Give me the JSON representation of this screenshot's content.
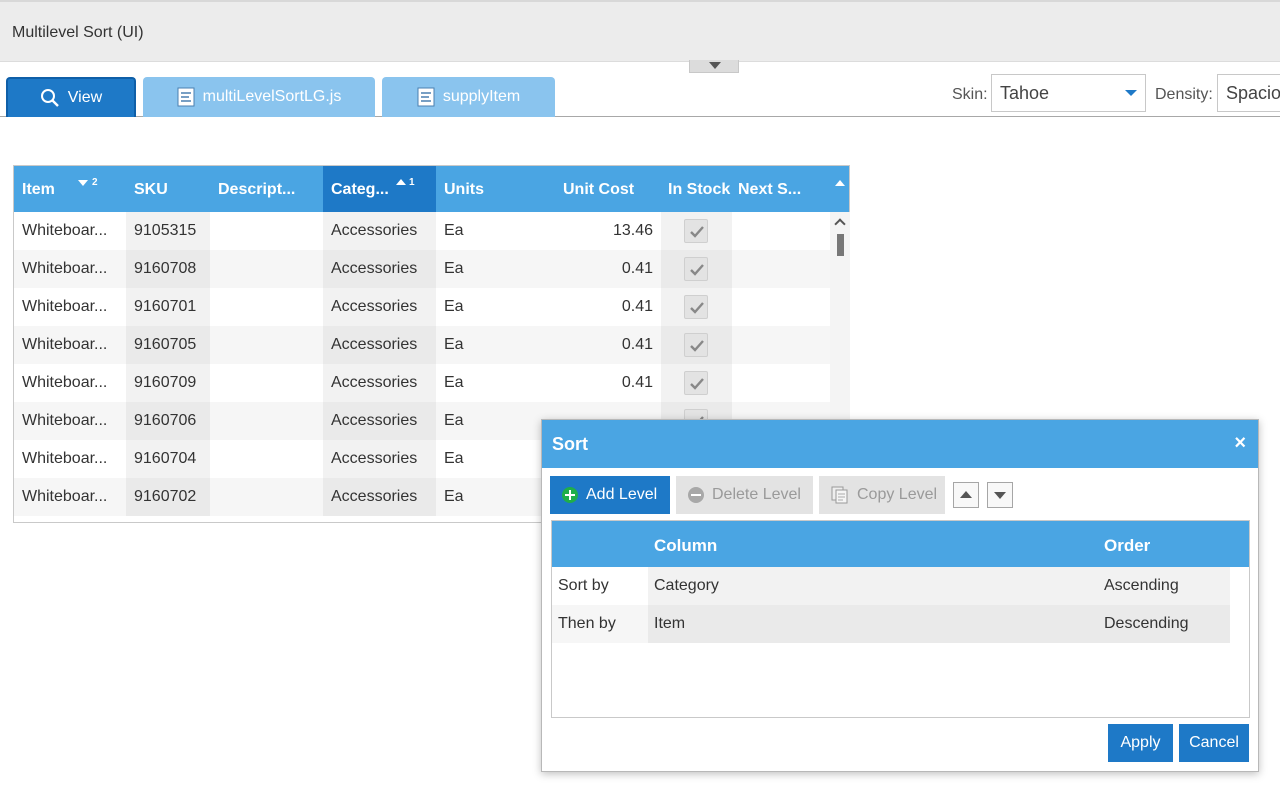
{
  "window": {
    "title": "Multilevel Sort (UI)"
  },
  "tabs": [
    {
      "label": "View",
      "icon": "search-icon",
      "active": true
    },
    {
      "label": "multiLevelSortLG.js",
      "icon": "document-icon",
      "active": false
    },
    {
      "label": "supplyItem",
      "icon": "document-icon",
      "active": false
    }
  ],
  "skin": {
    "label": "Skin:",
    "value": "Tahoe"
  },
  "density": {
    "label": "Density:",
    "value": "Spacious"
  },
  "grid": {
    "columns": [
      {
        "label": "Item",
        "sort": "descending",
        "sort_level": "2"
      },
      {
        "label": "SKU"
      },
      {
        "label": "Descript..."
      },
      {
        "label": "Categ...",
        "sort": "ascending",
        "sort_level": "1"
      },
      {
        "label": "Units"
      },
      {
        "label": "Unit Cost"
      },
      {
        "label": "In Stock"
      },
      {
        "label": "Next S..."
      }
    ],
    "rows": [
      {
        "item": "Whiteboar...",
        "sku": "9105315",
        "description": "",
        "category": "Accessories",
        "units": "Ea",
        "unit_cost": "13.46",
        "in_stock": true,
        "next_shipment": ""
      },
      {
        "item": "Whiteboar...",
        "sku": "9160708",
        "description": "",
        "category": "Accessories",
        "units": "Ea",
        "unit_cost": "0.41",
        "in_stock": true,
        "next_shipment": ""
      },
      {
        "item": "Whiteboar...",
        "sku": "9160701",
        "description": "",
        "category": "Accessories",
        "units": "Ea",
        "unit_cost": "0.41",
        "in_stock": true,
        "next_shipment": ""
      },
      {
        "item": "Whiteboar...",
        "sku": "9160705",
        "description": "",
        "category": "Accessories",
        "units": "Ea",
        "unit_cost": "0.41",
        "in_stock": true,
        "next_shipment": ""
      },
      {
        "item": "Whiteboar...",
        "sku": "9160709",
        "description": "",
        "category": "Accessories",
        "units": "Ea",
        "unit_cost": "0.41",
        "in_stock": true,
        "next_shipment": ""
      },
      {
        "item": "Whiteboar...",
        "sku": "9160706",
        "description": "",
        "category": "Accessories",
        "units": "Ea",
        "unit_cost": "",
        "in_stock": true,
        "next_shipment": ""
      },
      {
        "item": "Whiteboar...",
        "sku": "9160704",
        "description": "",
        "category": "Accessories",
        "units": "Ea",
        "unit_cost": "",
        "in_stock": true,
        "next_shipment": ""
      },
      {
        "item": "Whiteboar...",
        "sku": "9160702",
        "description": "",
        "category": "Accessories",
        "units": "Ea",
        "unit_cost": "",
        "in_stock": true,
        "next_shipment": ""
      }
    ]
  },
  "sort_dialog": {
    "title": "Sort",
    "close": "×",
    "toolbar": {
      "add_level": "Add Level",
      "delete_level": "Delete Level",
      "copy_level": "Copy Level"
    },
    "columns": {
      "column": "Column",
      "order": "Order"
    },
    "levels": [
      {
        "label": "Sort by",
        "column": "Category",
        "order": "Ascending"
      },
      {
        "label": "Then by",
        "column": "Item",
        "order": "Descending"
      }
    ],
    "apply": "Apply",
    "cancel": "Cancel"
  },
  "colors": {
    "header_blue": "#4aa5e3",
    "accent_blue": "#1e79c7",
    "tab_inactive": "#8ac4ee",
    "add_green": "#1fae49"
  }
}
